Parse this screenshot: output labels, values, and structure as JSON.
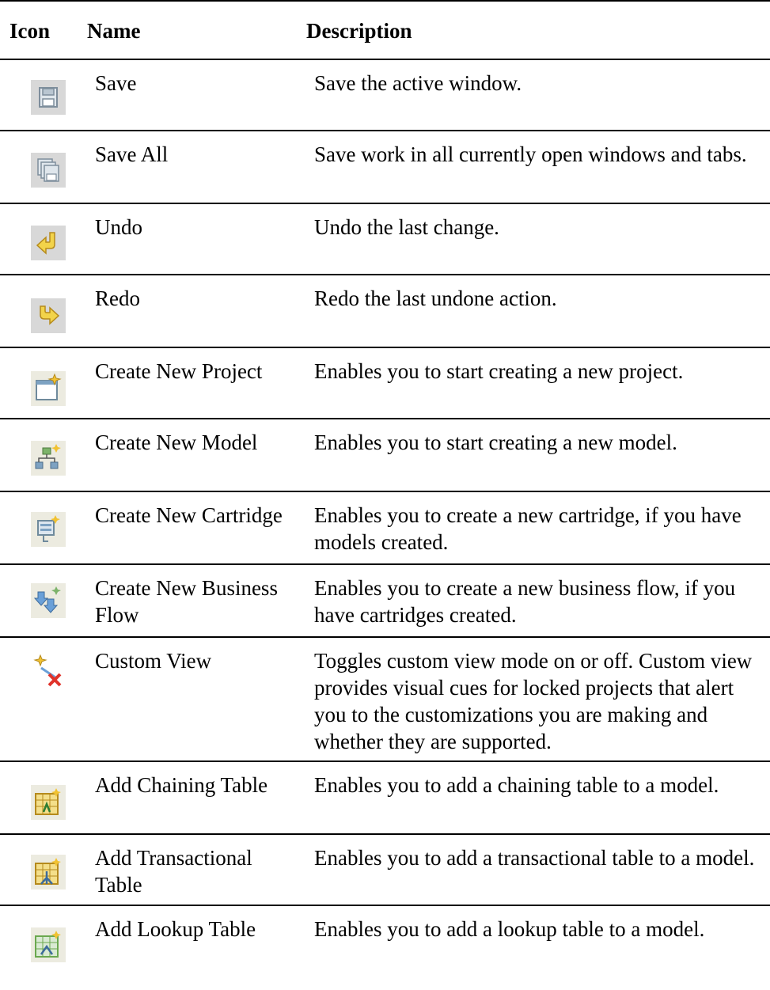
{
  "table": {
    "headers": {
      "icon": "Icon",
      "name": "Name",
      "description": "Description"
    },
    "rows": [
      {
        "icon": "save-icon",
        "name": "Save",
        "description": "Save the active window."
      },
      {
        "icon": "save-all-icon",
        "name": "Save All",
        "description": "Save work in all currently open windows and tabs."
      },
      {
        "icon": "undo-icon",
        "name": "Undo",
        "description": "Undo the last change."
      },
      {
        "icon": "redo-icon",
        "name": "Redo",
        "description": "Redo the last undone action."
      },
      {
        "icon": "new-project-icon",
        "name": "Create New Project",
        "description": "Enables you to start creating a new project."
      },
      {
        "icon": "new-model-icon",
        "name": "Create New Model",
        "description": "Enables you to start creating a new model."
      },
      {
        "icon": "new-cartridge-icon",
        "name": "Create New Cartridge",
        "description": "Enables you to create a new cartridge, if you have models created."
      },
      {
        "icon": "new-business-flow-icon",
        "name": "Create New Business Flow",
        "description": "Enables you to create a new business flow, if you have cartridges created."
      },
      {
        "icon": "custom-view-icon",
        "name": "Custom View",
        "description": "Toggles custom view mode on or off. Custom view provides visual cues for locked projects that alert you to the customizations you are making and whether they are supported."
      },
      {
        "icon": "chaining-table-icon",
        "name": "Add Chaining Table",
        "description": "Enables you to add a chaining table to a model."
      },
      {
        "icon": "transactional-table-icon",
        "name": "Add Transactional Table",
        "description": "Enables you to add a transactional table to a model."
      },
      {
        "icon": "lookup-table-icon",
        "name": "Add Lookup Table",
        "description": "Enables you to add a lookup table to a model."
      }
    ]
  }
}
